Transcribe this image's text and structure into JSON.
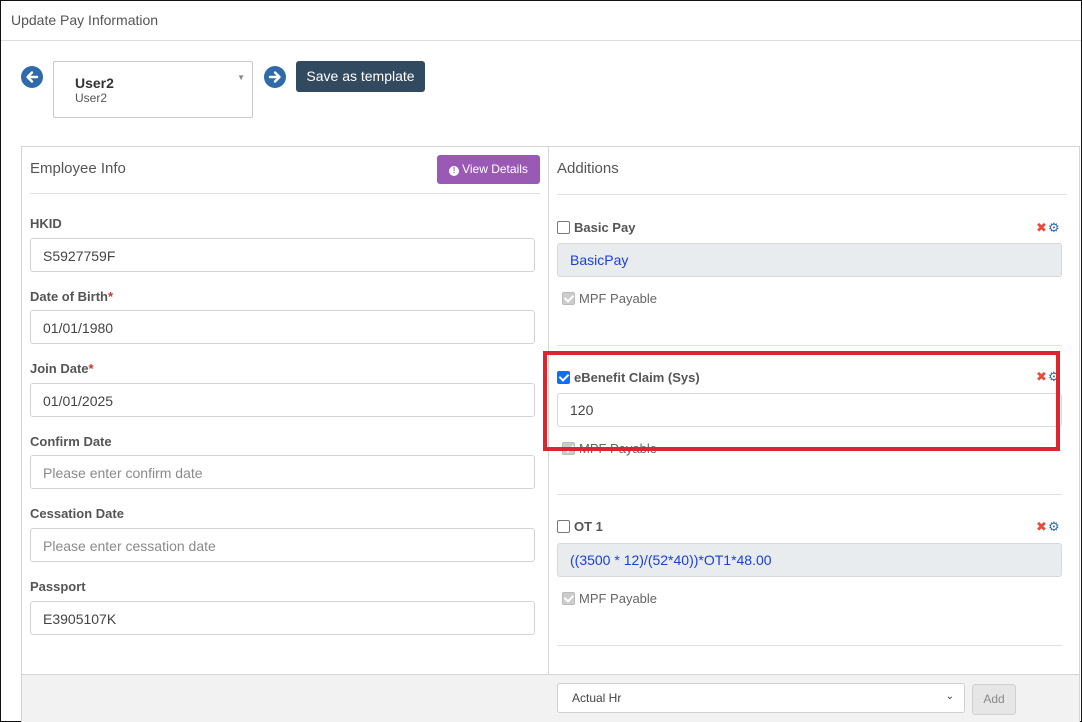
{
  "window": {
    "title": "Update Pay Information"
  },
  "user_selector": {
    "name": "User2",
    "sub": "User2"
  },
  "toolbar": {
    "save_template_label": "Save as template"
  },
  "employee_info": {
    "heading": "Employee Info",
    "view_details_label": "View Details",
    "fields": [
      {
        "label": "HKID",
        "required": false,
        "value": "S5927759F",
        "placeholder": ""
      },
      {
        "label": "Date of Birth",
        "required": true,
        "value": "01/01/1980",
        "placeholder": ""
      },
      {
        "label": "Join Date",
        "required": true,
        "value": "01/01/2025",
        "placeholder": ""
      },
      {
        "label": "Confirm Date",
        "required": false,
        "value": "",
        "placeholder": "Please enter confirm date"
      },
      {
        "label": "Cessation Date",
        "required": false,
        "value": "",
        "placeholder": "Please enter cessation date"
      },
      {
        "label": "Passport",
        "required": false,
        "value": "E3905107K",
        "placeholder": ""
      }
    ],
    "required_mark": "*"
  },
  "additions": {
    "heading": "Additions",
    "items": [
      {
        "label": "Basic Pay",
        "checked": false,
        "value": "BasicPay",
        "mpf_label": "MPF Payable"
      },
      {
        "label": "eBenefit Claim (Sys)",
        "checked": true,
        "value": "120",
        "mpf_label": "MPF Payable"
      },
      {
        "label": "OT 1",
        "checked": false,
        "value": "((3500 * 12)/(52*40))*OT1*48.00",
        "mpf_label": "MPF Payable"
      }
    ],
    "type_select": {
      "value": "Actual Hr"
    },
    "add_label": "Add"
  },
  "colors": {
    "save_button": "#324a5f",
    "view_details_button": "#9b59b6",
    "highlight": "#e0242b",
    "formula_text": "#1a3fd4"
  }
}
